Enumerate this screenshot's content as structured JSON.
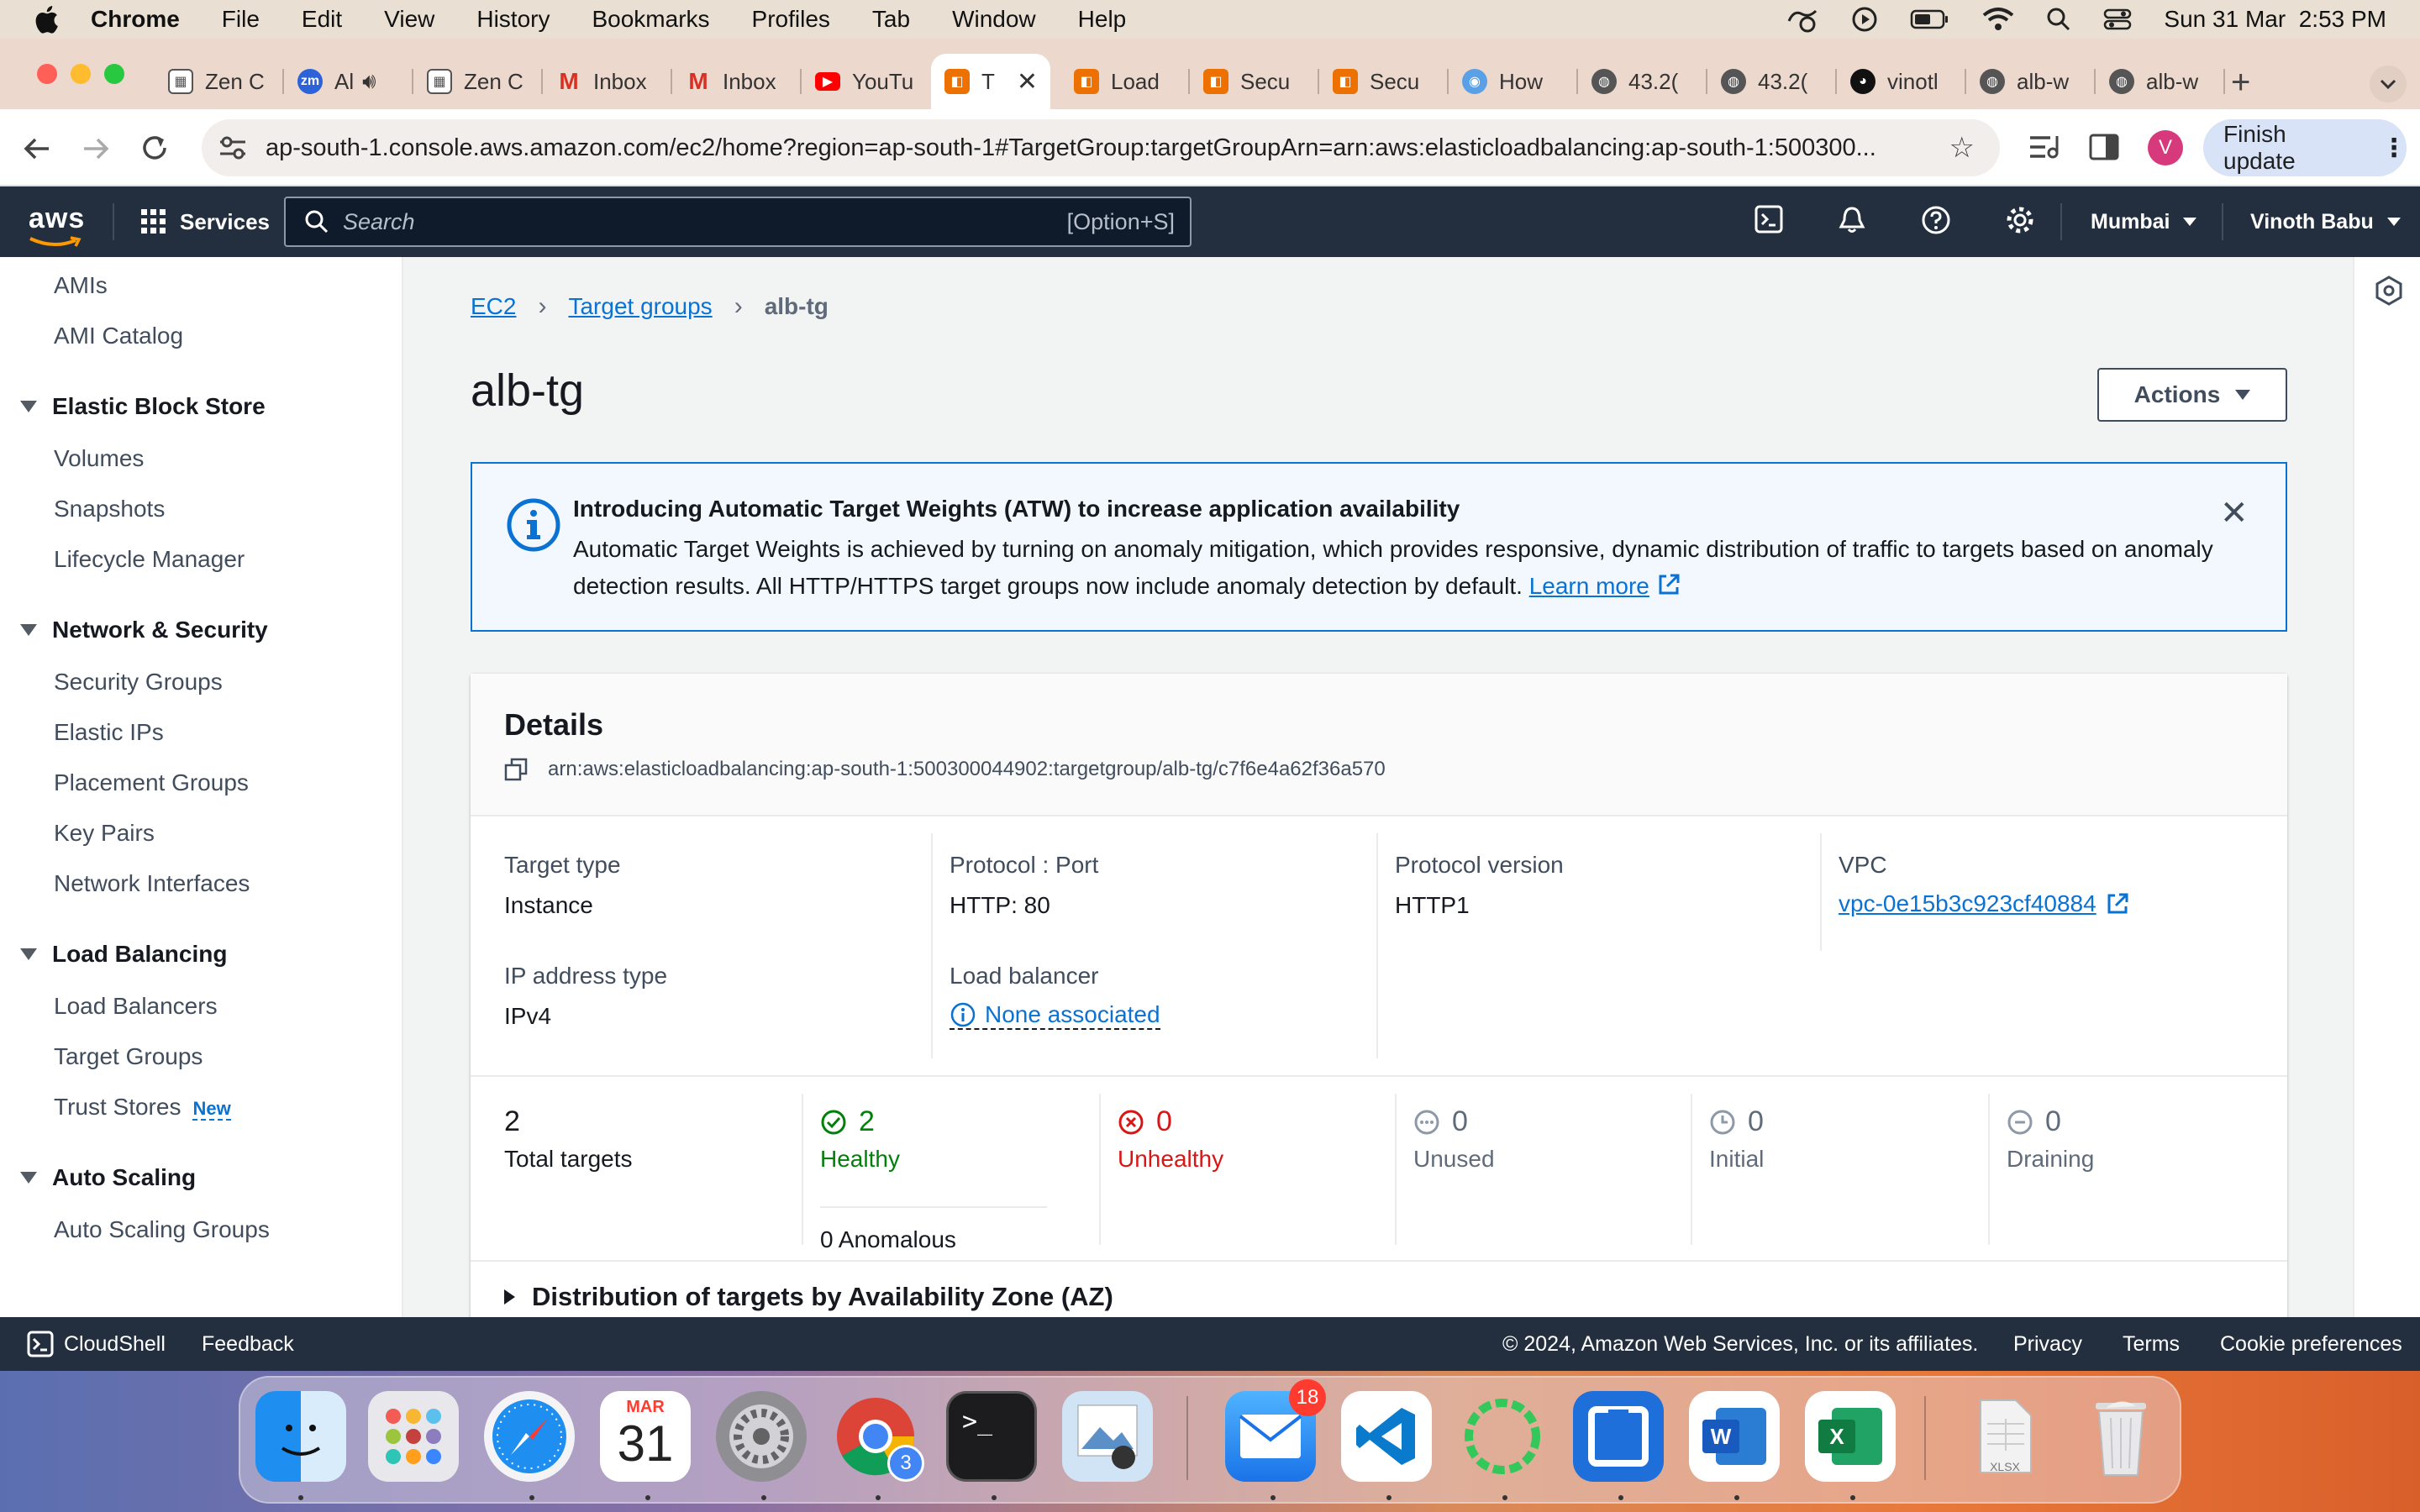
{
  "menubar": {
    "app_name": "Chrome",
    "items": [
      "File",
      "Edit",
      "View",
      "History",
      "Bookmarks",
      "Profiles",
      "Tab",
      "Window",
      "Help"
    ],
    "datetime": "Sun 31 Mar  2:53 PM"
  },
  "tabs": [
    {
      "title": "Zen C",
      "icon": "zen-icon"
    },
    {
      "title": "Al",
      "icon": "zoom-icon",
      "fav_text": "zm"
    },
    {
      "title": "Zen C",
      "icon": "zen-icon"
    },
    {
      "title": "Inbox",
      "icon": "gmail-icon"
    },
    {
      "title": "Inbox",
      "icon": "gmail-icon"
    },
    {
      "title": "YouTu",
      "icon": "youtube-icon"
    },
    {
      "title": "T",
      "icon": "aws-icon",
      "active": true
    },
    {
      "title": "Load",
      "icon": "aws-icon"
    },
    {
      "title": "Secu",
      "icon": "aws-icon"
    },
    {
      "title": "Secu",
      "icon": "aws-icon"
    },
    {
      "title": "How",
      "icon": "site-icon"
    },
    {
      "title": "43.2(",
      "icon": "globe-icon"
    },
    {
      "title": "43.2(",
      "icon": "globe-icon"
    },
    {
      "title": "vinotl",
      "icon": "github-icon"
    },
    {
      "title": "alb-w",
      "icon": "globe-icon"
    },
    {
      "title": "alb-w",
      "icon": "globe-icon"
    }
  ],
  "toolbar": {
    "url": "ap-south-1.console.aws.amazon.com/ec2/home?region=ap-south-1#TargetGroup:targetGroupArn=arn:aws:elasticloadbalancing:ap-south-1:500300...",
    "avatar_letter": "V",
    "finish_update_label": "Finish update"
  },
  "awsnav": {
    "logo": "aws",
    "services_label": "Services",
    "search_placeholder": "Search",
    "search_shortcut": "[Option+S]",
    "region": "Mumbai",
    "user": "Vinoth Babu"
  },
  "sidebar": {
    "top_items": [
      "AMIs",
      "AMI Catalog"
    ],
    "sections": [
      {
        "title": "Elastic Block Store",
        "items": [
          "Volumes",
          "Snapshots",
          "Lifecycle Manager"
        ]
      },
      {
        "title": "Network & Security",
        "items": [
          "Security Groups",
          "Elastic IPs",
          "Placement Groups",
          "Key Pairs",
          "Network Interfaces"
        ]
      },
      {
        "title": "Load Balancing",
        "items": [
          "Load Balancers",
          "Target Groups",
          "Trust Stores"
        ]
      },
      {
        "title": "Auto Scaling",
        "items": [
          "Auto Scaling Groups"
        ]
      }
    ],
    "new_badge": "New"
  },
  "breadcrumb": {
    "ec2": "EC2",
    "target_groups": "Target groups",
    "current": "alb-tg"
  },
  "page_title": "alb-tg",
  "actions_label": "Actions",
  "banner": {
    "title": "Introducing Automatic Target Weights (ATW) to increase application availability",
    "text": "Automatic Target Weights is achieved by turning on anomaly mitigation, which provides responsive, dynamic distribution of traffic to targets based on anomaly detection results. All HTTP/HTTPS target groups now include anomaly detection by default.",
    "learn_more": "Learn more"
  },
  "details": {
    "title": "Details",
    "arn": "arn:aws:elasticloadbalancing:ap-south-1:500300044902:targetgroup/alb-tg/c7f6e4a62f36a570",
    "target_type_label": "Target type",
    "target_type": "Instance",
    "protocol_port_label": "Protocol : Port",
    "protocol_port": "HTTP: 80",
    "protocol_version_label": "Protocol version",
    "protocol_version": "HTTP1",
    "vpc_label": "VPC",
    "vpc": "vpc-0e15b3c923cf40884",
    "ip_type_label": "IP address type",
    "ip_type": "IPv4",
    "lb_label": "Load balancer",
    "lb": "None associated"
  },
  "stats": {
    "total": {
      "value": "2",
      "label": "Total targets"
    },
    "healthy": {
      "value": "2",
      "label": "Healthy",
      "color": "#037f0c"
    },
    "anomalous": "0 Anomalous",
    "unhealthy": {
      "value": "0",
      "label": "Unhealthy",
      "color": "#d91515"
    },
    "unused": {
      "value": "0",
      "label": "Unused"
    },
    "initial": {
      "value": "0",
      "label": "Initial"
    },
    "draining": {
      "value": "0",
      "label": "Draining"
    }
  },
  "distribution_label": "Distribution of targets by Availability Zone (AZ)",
  "footer": {
    "cloudshell": "CloudShell",
    "feedback": "Feedback",
    "copyright": "© 2024, Amazon Web Services, Inc. or its affiliates.",
    "privacy": "Privacy",
    "terms": "Terms",
    "cookie": "Cookie preferences"
  },
  "dock": {
    "calendar_month": "MAR",
    "calendar_day": "31",
    "mail_badge": "18",
    "chrome_badge": "3",
    "xlsx_label": "XLSX"
  }
}
